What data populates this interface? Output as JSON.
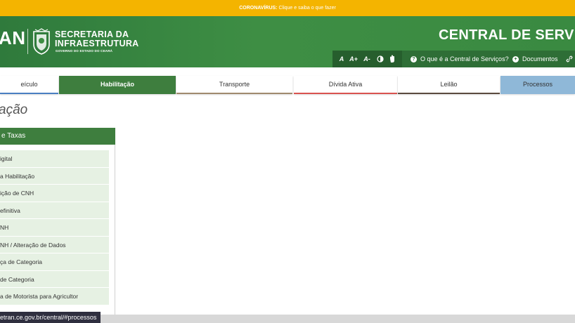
{
  "covid_banner": {
    "prefix": "CORONAVÍRUS:",
    "text": " Clique e saiba o que fazer"
  },
  "header": {
    "logo_text": "AN",
    "org_line1": "SECRETARIA DA",
    "org_line2": "INFRAESTRUTURA",
    "governo": "GOVERNO DO ESTADO DO CEARÁ",
    "title": "CENTRAL DE SERV"
  },
  "toolbar": {
    "font_increase": "A+",
    "font_normal": "A",
    "font_decrease": "A-",
    "contrast_icon": "contrast-icon",
    "libras_icon": "hand-icon",
    "about_label": "O que é a Central de Serviços?",
    "docs_label": "Documentos"
  },
  "tabs": [
    {
      "label": "eículo",
      "color": "#4a7fc1"
    },
    {
      "label": "Habilitação",
      "color": "#3e7e3e"
    },
    {
      "label": "Transporte",
      "color": "#a08a6e"
    },
    {
      "label": "Dívida Ativa",
      "color": "#d9534f"
    },
    {
      "label": "Leilão",
      "color": "#5a4a3e"
    },
    {
      "label": "Processos",
      "color": "#8fb8d8"
    }
  ],
  "page_title": "ação",
  "panel": {
    "title": "e Taxas",
    "items": [
      "igital",
      "a Habilitação",
      "ição de CNH",
      "efinitiva",
      "NH",
      "NH / Alteração de Dados",
      "ça de Categoria",
      "de Categoria",
      "a de Motorista para Agricultor"
    ]
  },
  "status_url": "etran.ce.gov.br/central/#processos",
  "colors": {
    "green": "#3e7e3e",
    "yellow": "#f4b400",
    "menu_bg": "#e6f1e3"
  }
}
